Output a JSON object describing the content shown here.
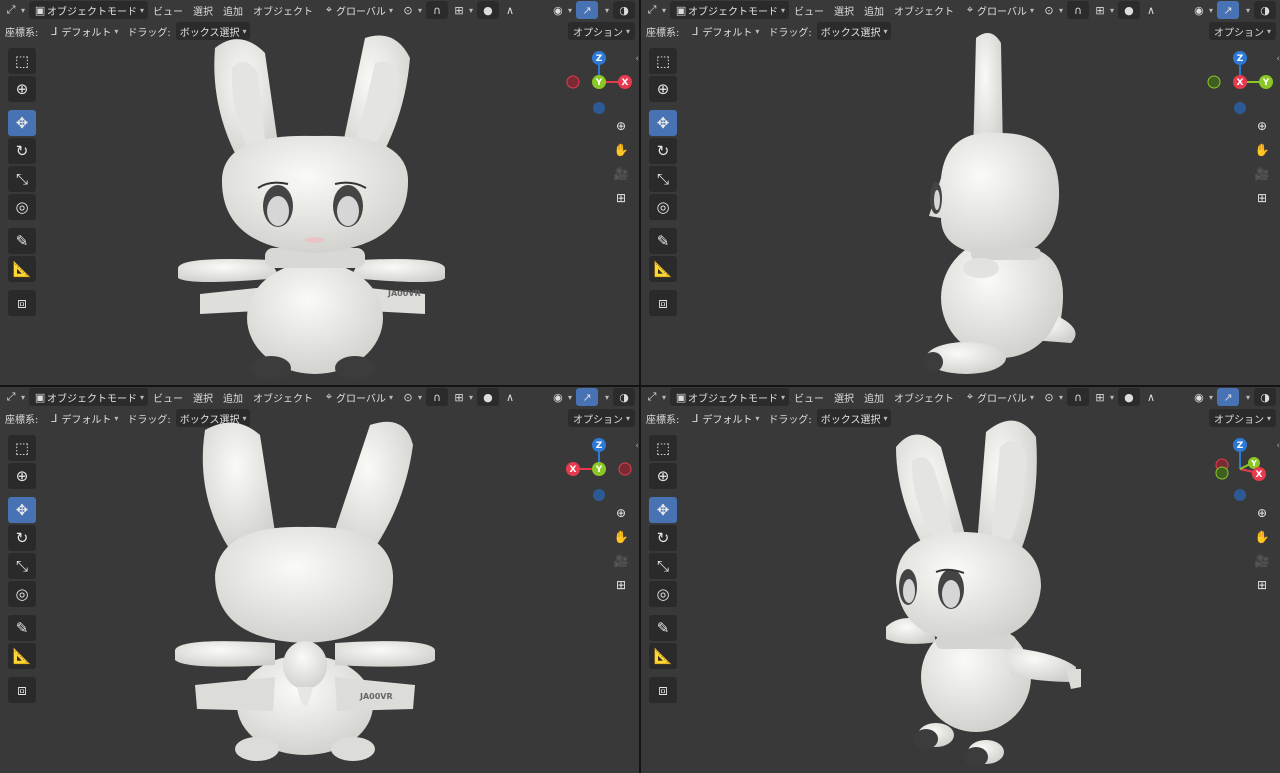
{
  "viewports": [
    {
      "id": "top-left",
      "view": "front"
    },
    {
      "id": "top-right",
      "view": "side"
    },
    {
      "id": "bottom-left",
      "view": "back"
    },
    {
      "id": "bottom-right",
      "view": "perspective"
    }
  ],
  "header": {
    "mode_label": "オブジェクトモード",
    "menu_view": "ビュー",
    "menu_select": "選択",
    "menu_add": "追加",
    "menu_object": "オブジェクト",
    "orientation_label": "グローバル"
  },
  "subheader": {
    "coord_label": "座標系:",
    "coord_value": "デフォルト",
    "drag_label": "ドラッグ:",
    "drag_value": "ボックス選択",
    "options_label": "オプション"
  },
  "model": {
    "tail_text": "JA00VR"
  },
  "gizmo": {
    "x": "X",
    "y": "Y",
    "z": "Z"
  },
  "colors": {
    "viewport_bg": "#393939",
    "accent": "#4772b3",
    "axis_x": "#e83a4f",
    "axis_y": "#8bc726",
    "axis_z": "#2d79d6"
  }
}
